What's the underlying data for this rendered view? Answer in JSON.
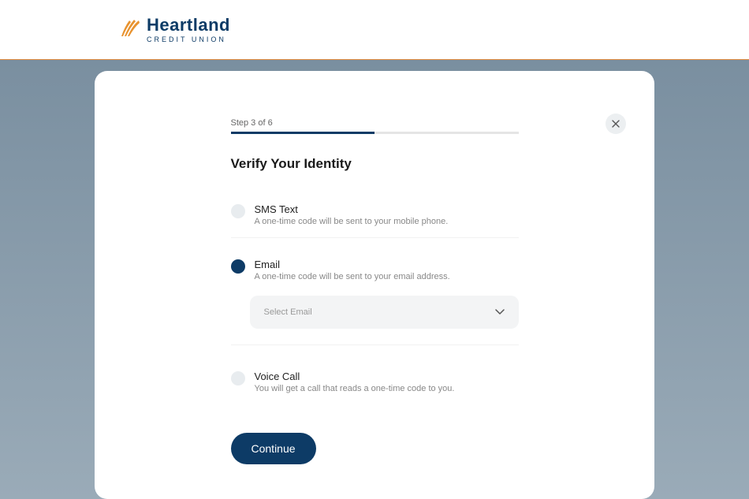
{
  "brand": {
    "main": "Heartland",
    "sub": "CREDIT UNION"
  },
  "step": {
    "label": "Step 3 of 6",
    "progress_percent": 50
  },
  "title": "Verify Your Identity",
  "options": {
    "sms": {
      "label": "SMS Text",
      "desc": "A one-time code will be sent to your mobile phone."
    },
    "email": {
      "label": "Email",
      "desc": "A one-time code will be sent to your email address.",
      "select_placeholder": "Select Email"
    },
    "voice": {
      "label": "Voice Call",
      "desc": "You will get a call that reads a one-time code to you."
    }
  },
  "continue_label": "Continue",
  "selected_option": "email"
}
